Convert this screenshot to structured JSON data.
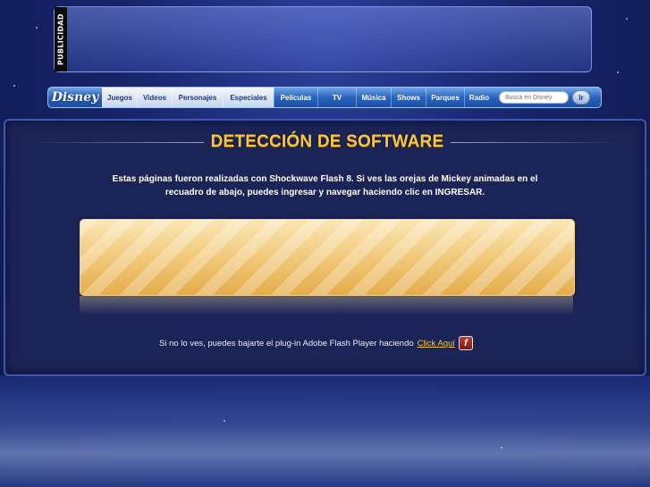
{
  "ad": {
    "label": "PUBLICIDAD"
  },
  "nav": {
    "logo": "Disney",
    "items": [
      {
        "label": "Juegos",
        "style": "light"
      },
      {
        "label": "Videos",
        "style": "light"
      },
      {
        "label": "Personajes",
        "style": "light"
      },
      {
        "label": "Especiales",
        "style": "light"
      },
      {
        "label": "Películas",
        "style": "dark"
      },
      {
        "label": "TV",
        "style": "dark"
      },
      {
        "label": "Música",
        "style": "dark"
      },
      {
        "label": "Shows",
        "style": "dark"
      },
      {
        "label": "Parques",
        "style": "dark"
      },
      {
        "label": "Radio",
        "style": "dark"
      }
    ],
    "search_placeholder": "Busca en Disney",
    "search_button": "Ir"
  },
  "main": {
    "title": "DETECCIÓN DE SOFTWARE",
    "intro": "Estas páginas fueron realizadas con Shockwave Flash 8. Si ves las orejas de Mickey animadas en el recuadro de abajo, puedes ingresar y navegar haciendo clic en INGRESAR.",
    "footer_text": "Si no lo ves, puedes bajarte el plug-in Adobe Flash Player haciendo",
    "footer_link": "Click Aquí",
    "flash_icon_glyph": "f"
  },
  "colors": {
    "accent": "#f6c543",
    "panel": "#1b2456"
  }
}
